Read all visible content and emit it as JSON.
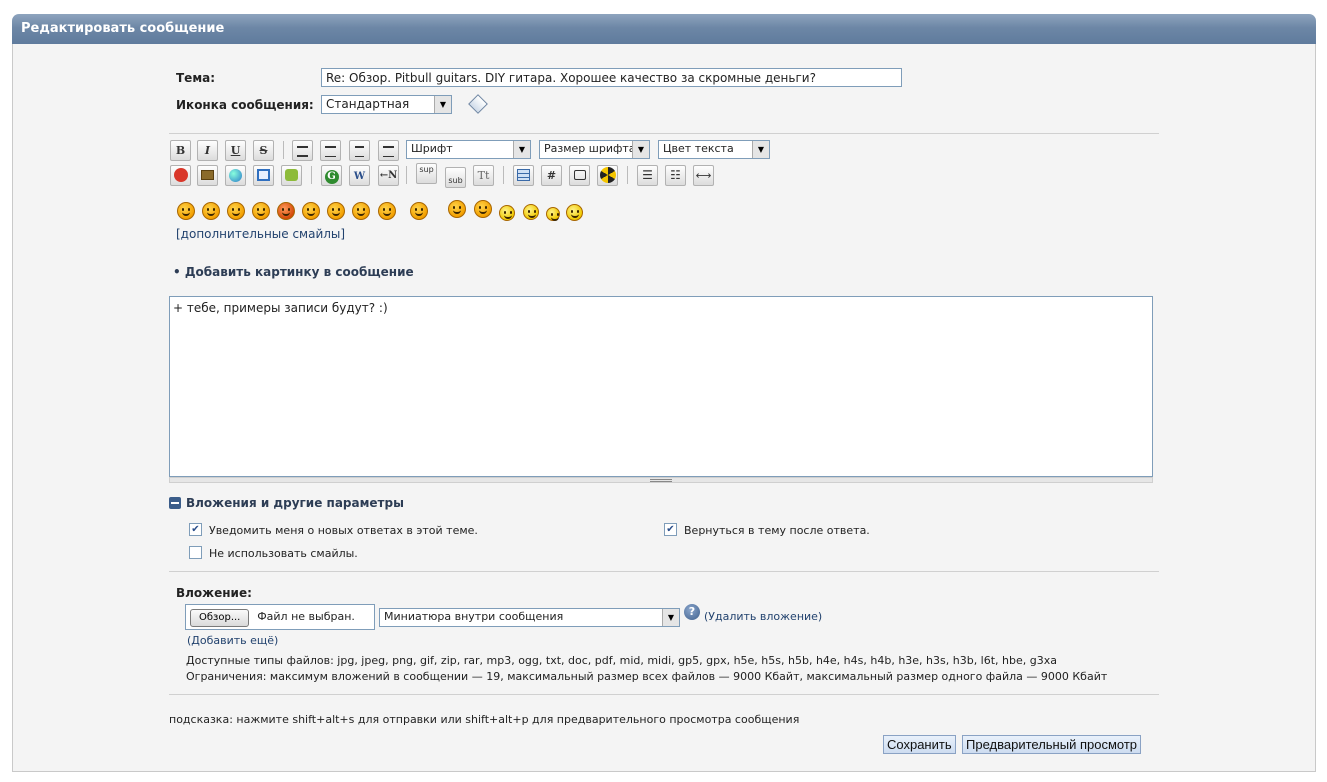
{
  "header": {
    "title": "Редактировать сообщение"
  },
  "form": {
    "subject_label": "Тема:",
    "subject_value": "Re: Обзор. Pitbull guitars. DIY гитара. Хорошее качество за скромные деньги?",
    "icon_label": "Иконка сообщения:",
    "icon_value": "Стандартная"
  },
  "toolbar": {
    "row1": [
      "B",
      "I",
      "U",
      "S"
    ],
    "font_select": "Шрифт",
    "size_select": "Размер шрифта",
    "color_select": "Цвет текста",
    "sup": "sup",
    "sub": "sub",
    "tt": "Tt",
    "hash": "#"
  },
  "smilies": {
    "more_link": "[дополнительные смайлы]"
  },
  "add_image": {
    "label": "Добавить картинку в сообщение"
  },
  "editor": {
    "text": "+ тебе, примеры записи будут?  :)"
  },
  "options": {
    "title": "Вложения и другие параметры",
    "notify_label": "Уведомить меня о новых ответах в этой теме.",
    "notify_checked": true,
    "return_label": "Вернуться в тему после ответа.",
    "return_checked": true,
    "no_smilies_label": "Не использовать смайлы.",
    "no_smilies_checked": false
  },
  "attachment": {
    "label": "Вложение:",
    "browse_button": "Обзор...",
    "file_status": "Файл не выбран.",
    "mode_select": "Миниатюра внутри сообщения",
    "delete_link": "(Удалить вложение)",
    "add_more_link": "(Добавить ещё)",
    "allowed_types": "Доступные типы файлов: jpg, jpeg, png, gif, zip, rar, mp3, ogg, txt, doc, pdf, mid, midi, gp5, gpx, h5e, h5s, h5b, h4e, h4s, h4b, h3e, h3s, h3b, l6t, hbe, g3xa",
    "limits": "Ограничения: максимум вложений в сообщении — 19, максимальный размер всех файлов — 9000 Кбайт, максимальный размер одного файла — 9000 Кбайт"
  },
  "footer": {
    "hint": "подсказка: нажмите shift+alt+s для отправки или shift+alt+p для предварительного просмотра сообщения",
    "save_button": "Сохранить",
    "preview_button": "Предварительный просмотр"
  }
}
